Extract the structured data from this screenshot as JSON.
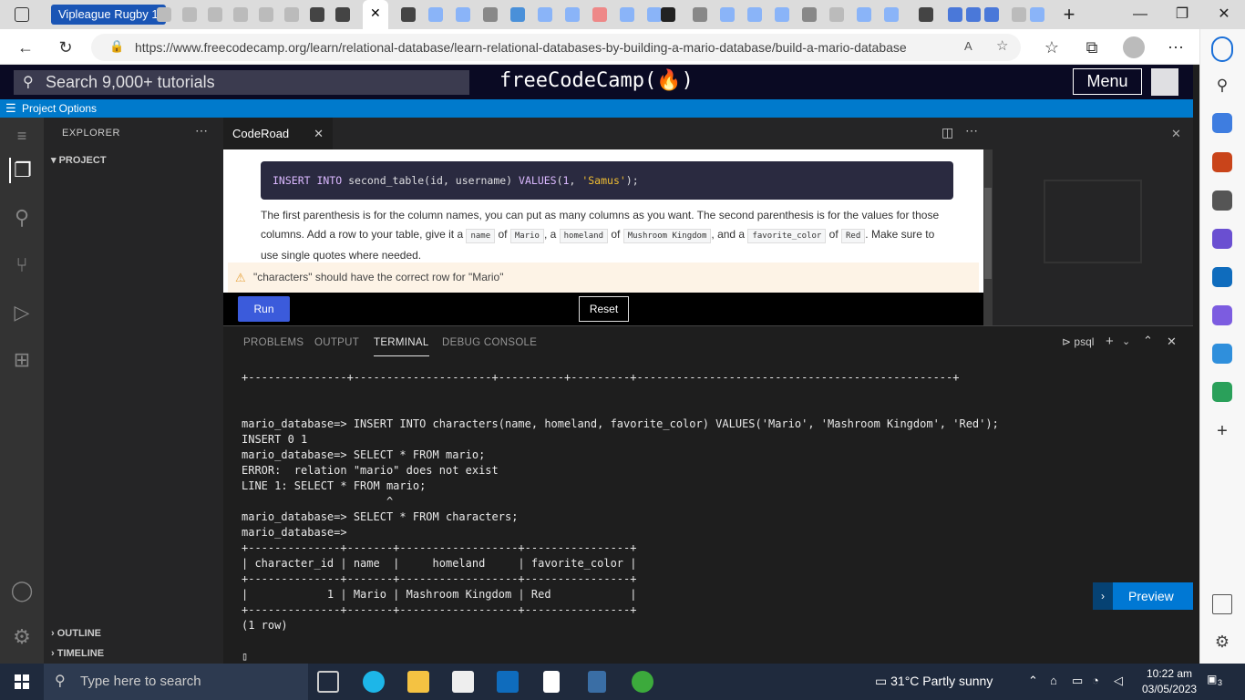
{
  "browser": {
    "active_tab_label": "Vipleague Rugby 1",
    "url": "https://www.freecodecamp.org/learn/relational-database/learn-relational-databases-by-building-a-mario-database/build-a-mario-database"
  },
  "fcc": {
    "search_placeholder": "Search 9,000+ tutorials",
    "logo": "freeCodeCamp(🔥)",
    "menu_label": "Menu",
    "project_options": "Project Options"
  },
  "vscode": {
    "explorer_title": "EXPLORER",
    "project_section": "PROJECT",
    "outline_section": "OUTLINE",
    "timeline_section": "TIMELINE",
    "editor_tab": "CodeRoad"
  },
  "lesson": {
    "code_example": {
      "kw1": "INSERT INTO",
      "mid": " second_table(id, username) ",
      "kw2": "VALUES",
      "args_open": "(",
      "num": "1",
      "sep": ", ",
      "str": "'Samus'",
      "args_close": ");"
    },
    "desc_1": "The first parenthesis is for the column names, you can put as many columns as you want. The second parenthesis is for the values for those columns. Add a row to your table, give it a",
    "code_name": "name",
    "of": "of",
    "code_mario": "Mario",
    "a": ", a",
    "code_homeland": "homeland",
    "code_mk": "Mushroom Kingdom",
    "and_a": ", and a",
    "code_fav": "favorite_color",
    "code_red": "Red",
    "desc_end": ". Make sure to use single quotes where needed.",
    "warning": "\"characters\" should have the correct row for \"Mario\"",
    "run_label": "Run",
    "reset_label": "Reset"
  },
  "panel": {
    "tabs": [
      "PROBLEMS",
      "OUTPUT",
      "TERMINAL",
      "DEBUG CONSOLE"
    ],
    "shell": "psql",
    "preview_label": "Preview"
  },
  "terminal_lines": [
    "+---------------+---------------------+----------+---------+------------------------------------------------+",
    "",
    "",
    "mario_database=> INSERT INTO characters(name, homeland, favorite_color) VALUES('Mario', 'Mashroom Kingdom', 'Red');",
    "INSERT 0 1",
    "mario_database=> SELECT * FROM mario;",
    "ERROR:  relation \"mario\" does not exist",
    "LINE 1: SELECT * FROM mario;",
    "                      ^",
    "mario_database=> SELECT * FROM characters;",
    "mario_database=>",
    "+--------------+-------+------------------+----------------+",
    "| character_id | name  |     homeland     | favorite_color |",
    "+--------------+-------+------------------+----------------+",
    "|            1 | Mario | Mashroom Kingdom | Red            |",
    "+--------------+-------+------------------+----------------+",
    "(1 row)",
    "",
    "▯"
  ],
  "taskbar": {
    "search_placeholder": "Type here to search",
    "weather": "31°C  Partly sunny",
    "time": "10:22 am",
    "date": "03/05/2023",
    "notifications": "3"
  }
}
